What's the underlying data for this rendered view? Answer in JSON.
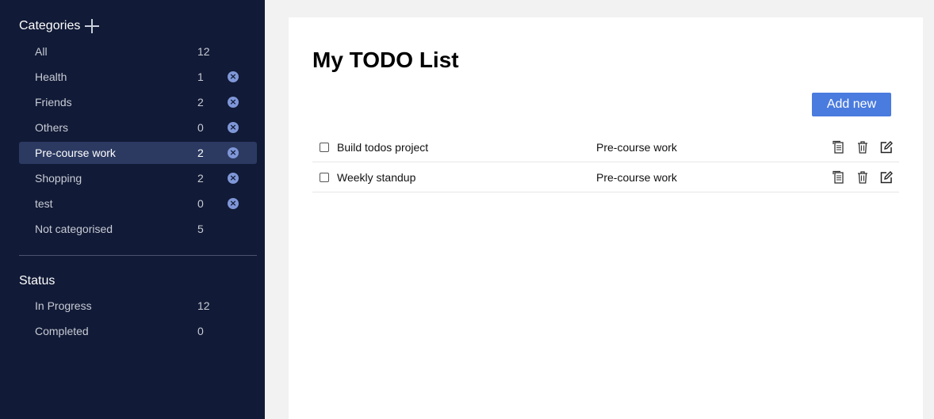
{
  "sidebar": {
    "categories_title": "Categories",
    "categories": [
      {
        "name": "All",
        "count": "12"
      },
      {
        "name": "Health",
        "count": "1"
      },
      {
        "name": "Friends",
        "count": "2"
      },
      {
        "name": "Others",
        "count": "0"
      },
      {
        "name": "Pre-course work",
        "count": "2"
      },
      {
        "name": "Shopping",
        "count": "2"
      },
      {
        "name": "test",
        "count": "0"
      },
      {
        "name": "Not categorised",
        "count": "5"
      }
    ],
    "status_title": "Status",
    "statuses": [
      {
        "name": "In Progress",
        "count": "12"
      },
      {
        "name": "Completed",
        "count": "0"
      }
    ],
    "active_category": "Pre-course work"
  },
  "main": {
    "title": "My TODO List",
    "add_button_label": "Add new",
    "todos": [
      {
        "title": "Build todos project",
        "category": "Pre-course work",
        "done": false
      },
      {
        "title": "Weekly standup",
        "category": "Pre-course work",
        "done": false
      }
    ]
  },
  "colors": {
    "sidebar_bg": "#111a36",
    "active_bg": "#2c3a62",
    "accent": "#4a7bde",
    "delete_icon": "#7f97d8"
  }
}
